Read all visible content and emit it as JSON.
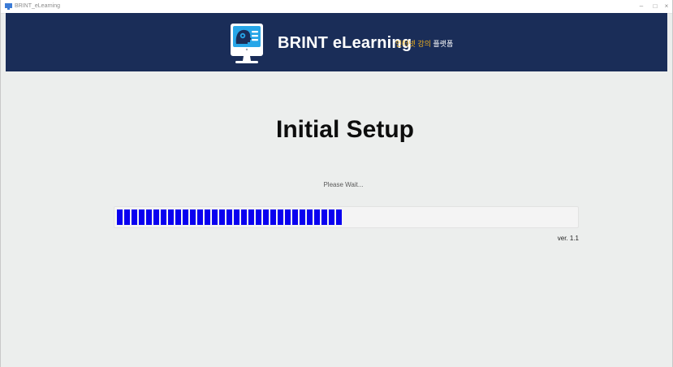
{
  "window": {
    "title": "BRINT_eLearning",
    "controls": {
      "minimize": "–",
      "maximize": "□",
      "close": "×"
    }
  },
  "header": {
    "brand": "BRINT eLearning",
    "tagline_part1": "인터넷 강의",
    "tagline_part2": " 플랫폼",
    "logo_icon": "monitor-head-icon"
  },
  "main": {
    "heading": "Initial Setup",
    "status_text": "Please Wait...",
    "progress": {
      "value": 0.5
    },
    "version": "ver. 1.1"
  },
  "colors": {
    "header_bg": "#1a2d58",
    "progress_fill": "#0a00f0",
    "tagline_accent": "#f1b21e",
    "content_bg": "#eceeed"
  }
}
